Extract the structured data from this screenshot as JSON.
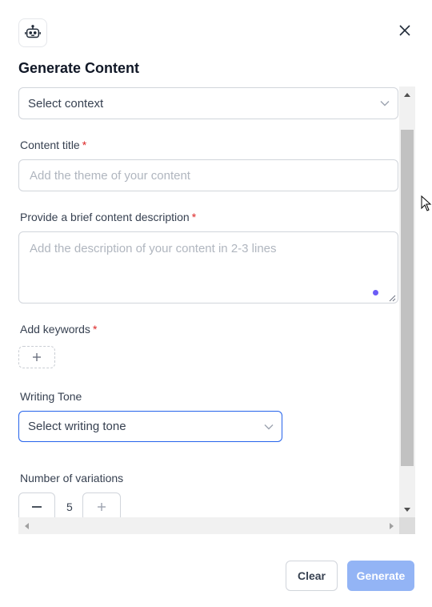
{
  "dialog": {
    "title": "Generate Content",
    "icons": {
      "logo": "robot-icon",
      "close": "close-icon"
    }
  },
  "form": {
    "context_select": {
      "value": "Select context"
    },
    "content_title": {
      "label": "Content title",
      "required": "*",
      "placeholder": "Add the theme of your content"
    },
    "description": {
      "label": "Provide a brief content description",
      "required": "*",
      "placeholder": "Add the description of your content in 2-3 lines"
    },
    "keywords": {
      "label": "Add keywords",
      "required": "*",
      "add_icon": "plus-icon"
    },
    "writing_tone": {
      "label": "Writing Tone",
      "value": "Select writing tone"
    },
    "variations": {
      "label": "Number of variations",
      "value": "5"
    }
  },
  "footer": {
    "clear_label": "Clear",
    "generate_label": "Generate"
  },
  "colors": {
    "accent": "#6b5cf6",
    "primary_disabled": "#93b4f5",
    "focus_border": "#2563eb",
    "required": "#dc2626"
  }
}
